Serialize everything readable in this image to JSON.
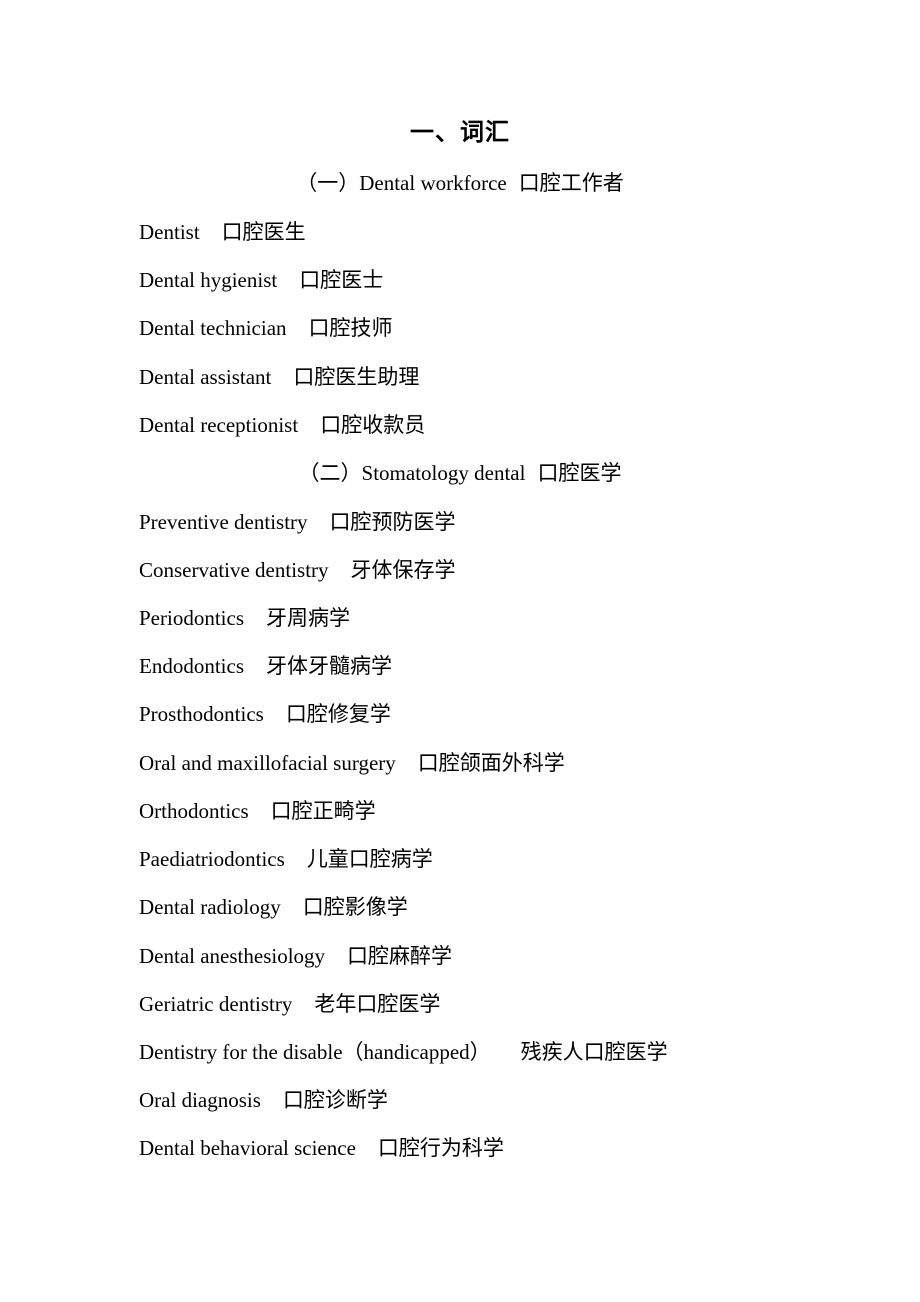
{
  "document": {
    "title": "一、词汇",
    "sections": [
      {
        "heading_en": "（一）Dental workforce",
        "heading_cn": "口腔工作者",
        "entries": [
          {
            "en": "Dentist",
            "cn": "口腔医生"
          },
          {
            "en": "Dental hygienist",
            "cn": "口腔医士"
          },
          {
            "en": "Dental technician",
            "cn": "口腔技师"
          },
          {
            "en": "Dental assistant",
            "cn": "口腔医生助理"
          },
          {
            "en": "Dental receptionist",
            "cn": "口腔收款员"
          }
        ]
      },
      {
        "heading_en": "（二）Stomatology dental",
        "heading_cn": "口腔医学",
        "entries": [
          {
            "en": "Preventive dentistry",
            "cn": "口腔预防医学"
          },
          {
            "en": "Conservative dentistry",
            "cn": "牙体保存学"
          },
          {
            "en": "Periodontics",
            "cn": "牙周病学"
          },
          {
            "en": "Endodontics",
            "cn": "牙体牙髓病学"
          },
          {
            "en": "Prosthodontics",
            "cn": "口腔修复学"
          },
          {
            "en": "Oral and maxillofacial surgery",
            "cn": "口腔颌面外科学"
          },
          {
            "en": "Orthodontics",
            "cn": "口腔正畸学"
          },
          {
            "en": "Paediatriodontics",
            "cn": "儿童口腔病学"
          },
          {
            "en": "Dental radiology",
            "cn": "口腔影像学"
          },
          {
            "en": "Dental anesthesiology",
            "cn": "口腔麻醉学"
          },
          {
            "en": "Geriatric dentistry",
            "cn": "老年口腔医学"
          },
          {
            "en": "Dentistry for the disable（handicapped）",
            "cn": "残疾人口腔医学"
          },
          {
            "en": "Oral diagnosis",
            "cn": "口腔诊断学"
          },
          {
            "en": "Dental behavioral science",
            "cn": "口腔行为科学"
          }
        ]
      }
    ]
  }
}
